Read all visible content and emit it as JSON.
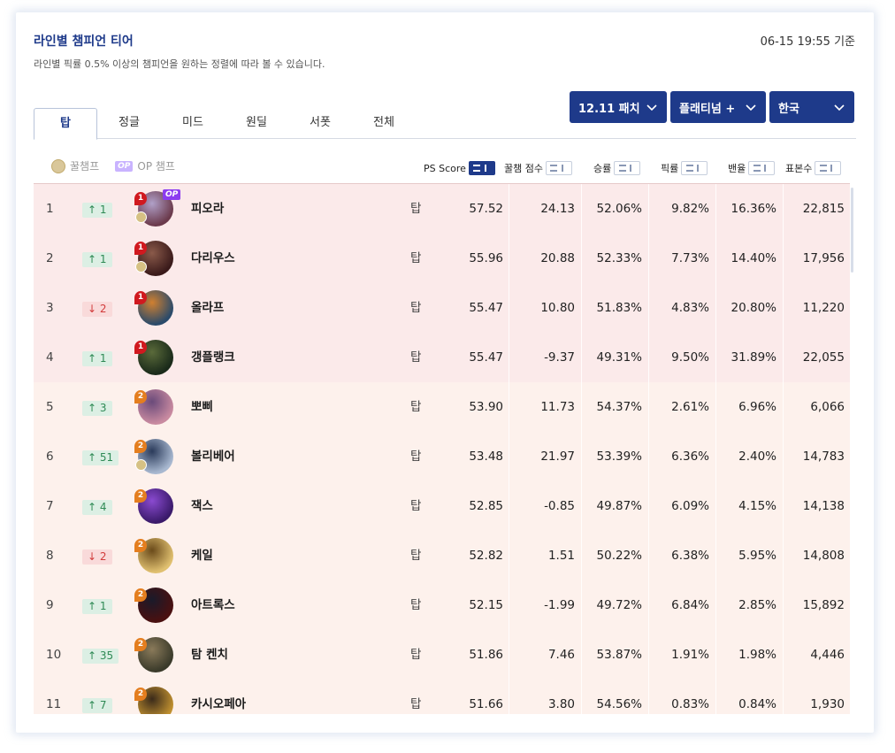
{
  "header": {
    "title": "라인별 챔피언 티어",
    "subtitle": "라인별 픽률 0.5% 이상의 챔피언을 원하는 정렬에 따라 볼 수 있습니다.",
    "timestamp": "06-15 19:55 기준"
  },
  "filters": {
    "patch": "12.11 패치",
    "tier": "플래티넘 +",
    "region": "한국"
  },
  "tabs": [
    "탑",
    "정글",
    "미드",
    "원딜",
    "서폿",
    "전체"
  ],
  "legend": {
    "honey": "꿀챔프",
    "op_badge": "OP",
    "op": "OP 챔프"
  },
  "columns": {
    "ps_score": "PS Score",
    "honey_score": "꿀챔 점수",
    "win_rate": "승률",
    "pick_rate": "픽률",
    "ban_rate": "밴율",
    "samples": "표본수"
  },
  "badges": {
    "op": "OP"
  },
  "rows": [
    {
      "rank": "1",
      "change": "↑ 1",
      "dir": "up",
      "tier": "1",
      "honey": true,
      "op": true,
      "name": "피오라",
      "lane": "탑",
      "ps": "57.52",
      "hs": "24.13",
      "wr": "52.06%",
      "pr": "9.82%",
      "br": "16.36%",
      "sm": "22,815",
      "color1": "#6b3a4c",
      "color2": "#b0a0c8"
    },
    {
      "rank": "2",
      "change": "↑ 1",
      "dir": "up",
      "tier": "1",
      "honey": true,
      "op": false,
      "name": "다리우스",
      "lane": "탑",
      "ps": "55.96",
      "hs": "20.88",
      "wr": "52.33%",
      "pr": "7.73%",
      "br": "14.40%",
      "sm": "17,956",
      "color1": "#3a1a1a",
      "color2": "#8a5a4a"
    },
    {
      "rank": "3",
      "change": "↓ 2",
      "dir": "down",
      "tier": "1",
      "honey": false,
      "op": false,
      "name": "올라프",
      "lane": "탑",
      "ps": "55.47",
      "hs": "10.80",
      "wr": "51.83%",
      "pr": "4.83%",
      "br": "20.80%",
      "sm": "11,220",
      "color1": "#2a4a6a",
      "color2": "#d08030"
    },
    {
      "rank": "4",
      "change": "↑ 1",
      "dir": "up",
      "tier": "1",
      "honey": false,
      "op": false,
      "name": "갱플랭크",
      "lane": "탑",
      "ps": "55.47",
      "hs": "-9.37",
      "wr": "49.31%",
      "pr": "9.50%",
      "br": "31.89%",
      "sm": "22,055",
      "color1": "#1a2a1a",
      "color2": "#5a6a3a"
    },
    {
      "rank": "5",
      "change": "↑ 3",
      "dir": "up",
      "tier": "2",
      "honey": false,
      "op": false,
      "name": "뽀삐",
      "lane": "탑",
      "ps": "53.90",
      "hs": "11.73",
      "wr": "54.37%",
      "pr": "2.61%",
      "br": "6.96%",
      "sm": "6,066",
      "color1": "#c88aa0",
      "color2": "#6a4a7a"
    },
    {
      "rank": "6",
      "change": "↑ 51",
      "dir": "up",
      "tier": "2",
      "honey": true,
      "op": false,
      "name": "볼리베어",
      "lane": "탑",
      "ps": "53.48",
      "hs": "21.97",
      "wr": "53.39%",
      "pr": "6.36%",
      "br": "2.40%",
      "sm": "14,783",
      "color1": "#a8b8d0",
      "color2": "#2a3a5a"
    },
    {
      "rank": "7",
      "change": "↑ 4",
      "dir": "up",
      "tier": "2",
      "honey": false,
      "op": false,
      "name": "잭스",
      "lane": "탑",
      "ps": "52.85",
      "hs": "-0.85",
      "wr": "49.87%",
      "pr": "6.09%",
      "br": "4.15%",
      "sm": "14,138",
      "color1": "#3a1a6a",
      "color2": "#8a4ad0"
    },
    {
      "rank": "8",
      "change": "↓ 2",
      "dir": "down",
      "tier": "2",
      "honey": false,
      "op": false,
      "name": "케일",
      "lane": "탑",
      "ps": "52.82",
      "hs": "1.51",
      "wr": "50.22%",
      "pr": "6.38%",
      "br": "5.95%",
      "sm": "14,808",
      "color1": "#e0c070",
      "color2": "#6a4a1a"
    },
    {
      "rank": "9",
      "change": "↑ 1",
      "dir": "up",
      "tier": "2",
      "honey": false,
      "op": false,
      "name": "아트록스",
      "lane": "탑",
      "ps": "52.15",
      "hs": "-1.99",
      "wr": "49.72%",
      "pr": "6.84%",
      "br": "2.85%",
      "sm": "15,892",
      "color1": "#4a1010",
      "color2": "#1a1a2a"
    },
    {
      "rank": "10",
      "change": "↑ 35",
      "dir": "up",
      "tier": "2",
      "honey": false,
      "op": false,
      "name": "탐 켄치",
      "lane": "탑",
      "ps": "51.86",
      "hs": "7.46",
      "wr": "53.87%",
      "pr": "1.91%",
      "br": "1.98%",
      "sm": "4,446",
      "color1": "#3a3a2a",
      "color2": "#8a7a5a"
    },
    {
      "rank": "11",
      "change": "↑ 7",
      "dir": "up",
      "tier": "2",
      "honey": false,
      "op": false,
      "name": "카시오페아",
      "lane": "탑",
      "ps": "51.66",
      "hs": "3.80",
      "wr": "54.56%",
      "pr": "0.83%",
      "br": "0.84%",
      "sm": "1,930",
      "color1": "#c09030",
      "color2": "#3a2a1a"
    }
  ]
}
